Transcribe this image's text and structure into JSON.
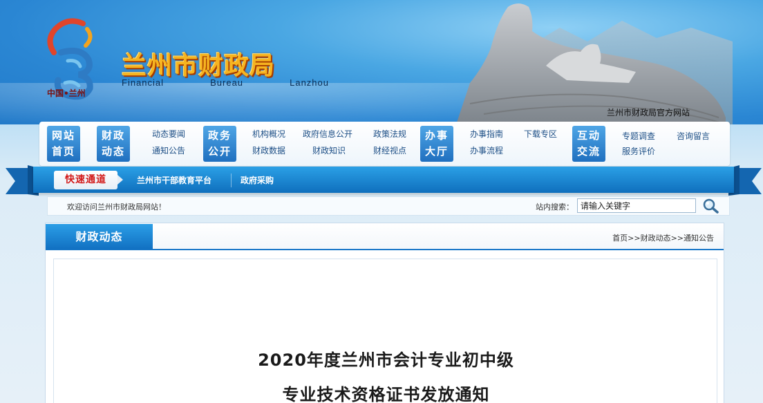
{
  "header": {
    "site_title": "兰州市财政局",
    "subtitle_words": [
      "Financial",
      "Bureau",
      "Lanzhou"
    ],
    "logo_caption": "中国•兰州",
    "official_tag": "兰州市财政局官方网站"
  },
  "nav": {
    "blocks": [
      {
        "line1": "网站",
        "line2": "首页"
      },
      {
        "line1": "财政",
        "line2": "动态"
      },
      {
        "line1": "政务",
        "line2": "公开"
      },
      {
        "line1": "办事",
        "line2": "大厅"
      },
      {
        "line1": "互动",
        "line2": "交流"
      }
    ],
    "links": {
      "dynamics_news": "动态要闻",
      "notice": "通知公告",
      "org_overview": "机构概况",
      "finance_data": "财政数据",
      "gov_info_open": "政府信息公开",
      "finance_knowledge": "财政知识",
      "policy_law": "政策法规",
      "finance_view": "财经视点",
      "guide": "办事指南",
      "process": "办事流程",
      "download": "下载专区",
      "survey": "专题调查",
      "message": "咨询留言",
      "service_eval": "服务评价"
    }
  },
  "quickbar": {
    "label": "快速通道",
    "links": [
      "兰州市干部教育平台",
      "政府采购"
    ]
  },
  "welcome": {
    "text": "欢迎访问兰州市财政局网站！",
    "search_label": "站内搜索：",
    "search_value": "请输入关键字"
  },
  "panel": {
    "tab_label": "财政动态",
    "breadcrumb": [
      "首页",
      ">>",
      "财政动态",
      ">>",
      "通知公告"
    ],
    "article_title_line1": "2020年度兰州市会计专业初中级",
    "article_title_line2": "专业技术资格证书发放通知"
  },
  "colors": {
    "nav_block": "#1f6fbf",
    "quickbar": "#0f6fbd",
    "quick_label_text": "#d21818",
    "title_gold": "#f6b420"
  }
}
